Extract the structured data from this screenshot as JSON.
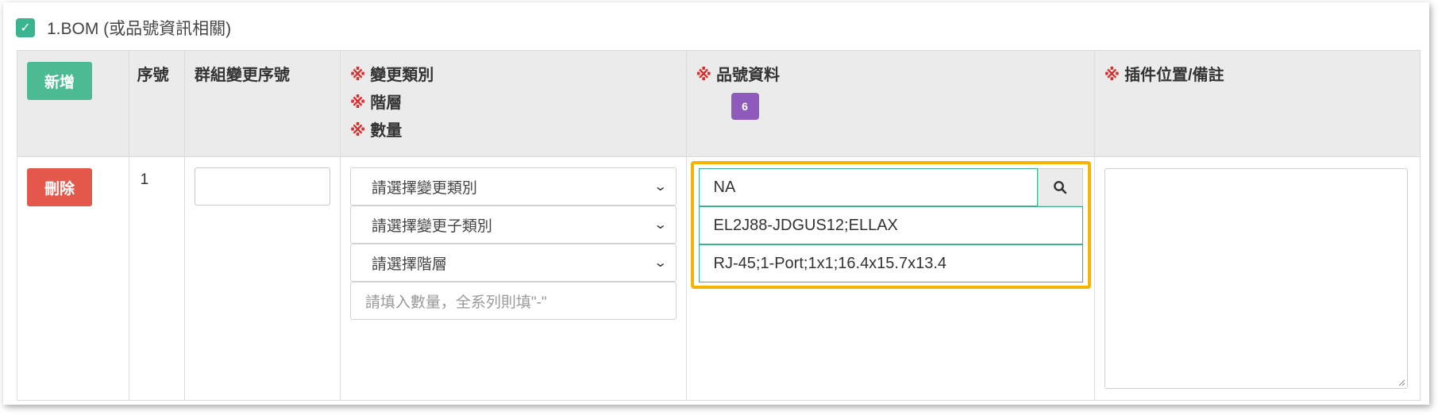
{
  "section": {
    "title": "1.BOM (或品號資訊相關)",
    "checked": true,
    "checkbox_color": "#3bb58f"
  },
  "header": {
    "add_button": "新增",
    "seq": "序號",
    "group_seq": "群組變更序號",
    "required_mark": "※",
    "change_type": "變更類別",
    "level": "階層",
    "quantity": "數量",
    "part_info": "品號資料",
    "part_badge": "6",
    "position_note": "插件位置/備註"
  },
  "row": {
    "delete_button": "刪除",
    "seq_value": "1",
    "group_seq_value": "",
    "change_type_select": "請選擇變更類別",
    "change_subtype_select": "請選擇變更子類別",
    "level_select": "請選擇階層",
    "quantity_placeholder": "請填入數量，全系列則填\"-\"",
    "part_number": "NA",
    "part_spec": "EL2J88-JDGUS12;ELLAX",
    "part_desc": "RJ-45;1-Port;1x1;16.4x15.7x13.4",
    "position_note_value": ""
  },
  "colors": {
    "add": "#4cbb93",
    "delete": "#e4574b",
    "badge": "#8e5bbd",
    "highlight": "#f5b400",
    "required": "#e02b2b"
  }
}
